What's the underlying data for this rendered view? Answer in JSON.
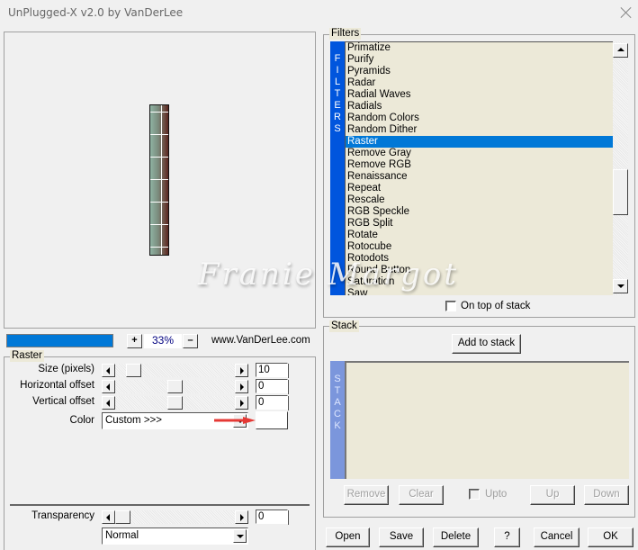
{
  "window": {
    "title": "UnPlugged-X v2.0 by VanDerLee",
    "close_icon": "close-icon"
  },
  "preview": {
    "zoom_in_label": "+",
    "zoom_value": "33%",
    "zoom_out_label": "–",
    "website": "www.VanDerLee.com",
    "progress_fraction": 1.0
  },
  "raster": {
    "group_label": "Raster",
    "params": [
      {
        "label": "Size (pixels)",
        "value": "10",
        "slider_fraction": 0.1
      },
      {
        "label": "Horizontal offset",
        "value": "0",
        "slider_fraction": 0.5
      },
      {
        "label": "Vertical offset",
        "value": "0",
        "slider_fraction": 0.5
      }
    ],
    "color_label": "Color",
    "color_value": "Custom >>>",
    "color_swatch": "#ffffff",
    "transparency_label": "Transparency",
    "transparency_value": "0",
    "transparency_fraction": 0.0,
    "blend_mode": "Normal"
  },
  "filters": {
    "group_label": "Filters",
    "strip_label": "FILTERS",
    "items": [
      "Primatize",
      "Purify",
      "Pyramids",
      "Radar",
      "Radial Waves",
      "Radials",
      "Random Colors",
      "Random Dither",
      "Raster",
      "Remove Gray",
      "Remove RGB",
      "Renaissance",
      "Repeat",
      "Rescale",
      "RGB Speckle",
      "RGB Split",
      "Rotate",
      "Rotocube",
      "Rotodots",
      "Round Button",
      "Saturation",
      "Saw"
    ],
    "selected": "Raster",
    "on_top_label": "On top of stack",
    "on_top_checked": false
  },
  "stack": {
    "group_label": "Stack",
    "add_label": "Add to stack",
    "strip_label": "STACK",
    "remove_label": "Remove",
    "clear_label": "Clear",
    "upto_label": "Upto",
    "up_label": "Up",
    "down_label": "Down"
  },
  "footer": {
    "open_label": "Open",
    "save_label": "Save",
    "delete_label": "Delete",
    "help_label": "?",
    "cancel_label": "Cancel",
    "ok_label": "OK"
  },
  "watermark": "Franie Margot",
  "colors": {
    "accent": "#0078d7",
    "filters_strip": "#0055dd",
    "stack_strip": "#7b96dc",
    "list_bg": "#ece9d8",
    "annotation_arrow": "#e53935"
  }
}
